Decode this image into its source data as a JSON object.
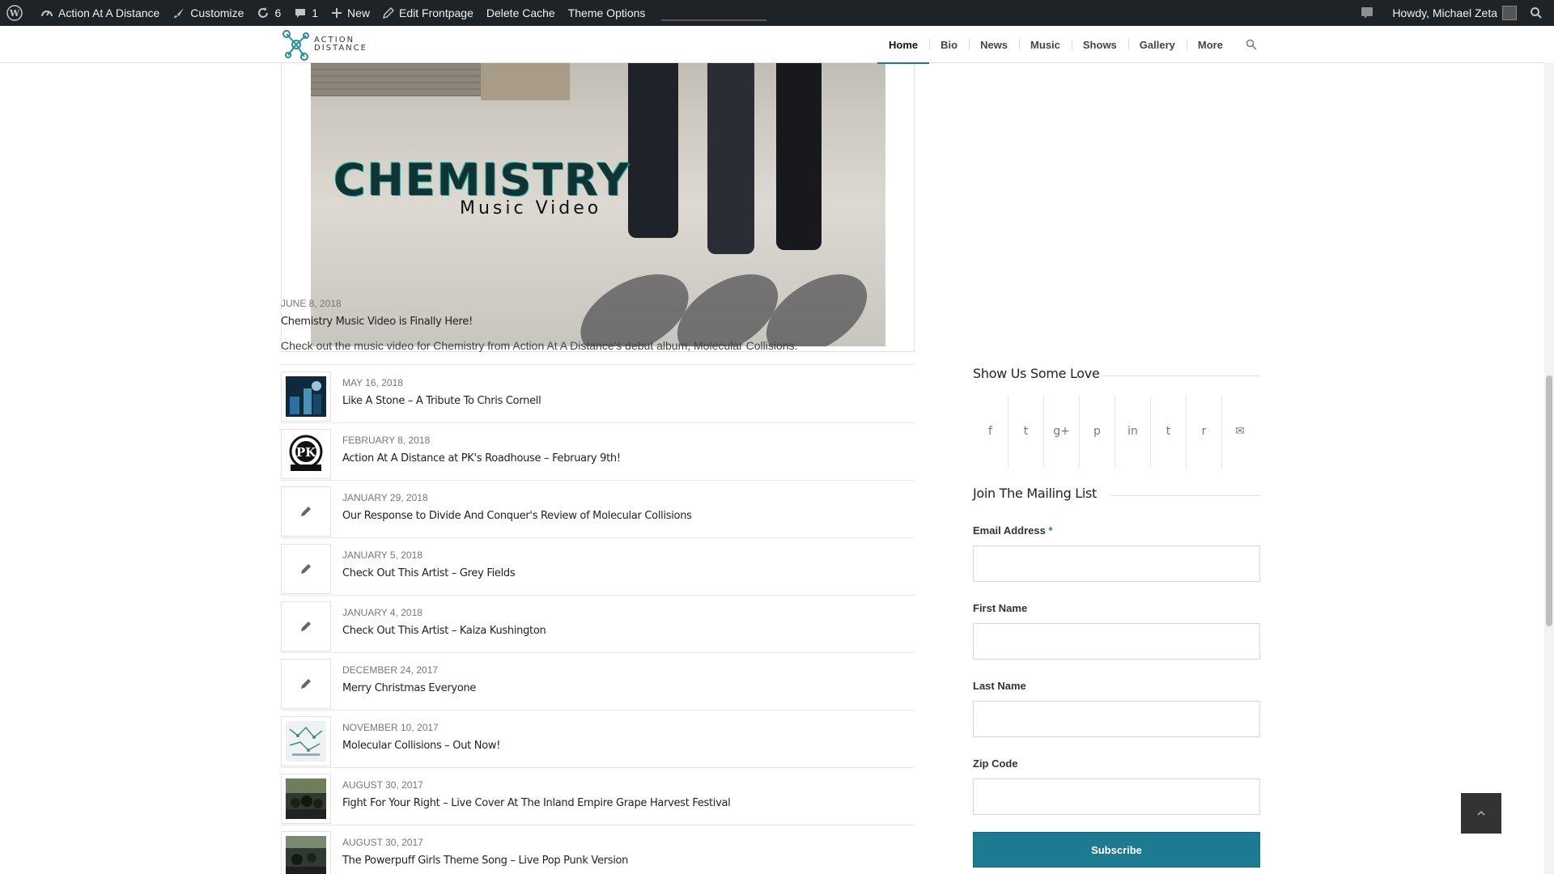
{
  "adminbar": {
    "site_name": "Action At A Distance",
    "customize": "Customize",
    "updates_count": "6",
    "comments_count": "1",
    "new": "New",
    "edit_frontpage": "Edit Frontpage",
    "delete_cache": "Delete Cache",
    "theme_options": "Theme Options",
    "howdy": "Howdy, Michael Zeta"
  },
  "logo": {
    "line1": "ACTION",
    "line2": "DISTANCE"
  },
  "nav": {
    "items": [
      {
        "label": "Home",
        "active": true
      },
      {
        "label": "Bio"
      },
      {
        "label": "News"
      },
      {
        "label": "Music"
      },
      {
        "label": "Shows"
      },
      {
        "label": "Gallery"
      },
      {
        "label": "More"
      }
    ]
  },
  "featured": {
    "image_title": "CHEMISTRY",
    "image_subtitle": "Music Video",
    "date": "JUNE 8, 2018",
    "title": "Chemistry Music Video is Finally Here!",
    "excerpt": "Check out the music video for Chemistry from Action At A Distance's debut album, Molecular Collisions."
  },
  "posts": [
    {
      "date": "MAY 16, 2018",
      "title": "Like A Stone – A Tribute To Chris Cornell",
      "thumb": "photo-dark"
    },
    {
      "date": "FEBRUARY 8, 2018",
      "title": "Action At A Distance at PK's Roadhouse – February 9th!",
      "thumb": "pk-logo"
    },
    {
      "date": "JANUARY 29, 2018",
      "title": "Our Response to Divide And Conquer's Review of Molecular Collisions",
      "thumb": "pencil-icon"
    },
    {
      "date": "JANUARY 5, 2018",
      "title": "Check Out This Artist – Grey Fields",
      "thumb": "pencil-icon"
    },
    {
      "date": "JANUARY 4, 2018",
      "title": "Check Out This Artist – Kaiza Kushington",
      "thumb": "pencil-icon"
    },
    {
      "date": "DECEMBER 24, 2017",
      "title": "Merry Christmas Everyone",
      "thumb": "pencil-icon"
    },
    {
      "date": "NOVEMBER 10, 2017",
      "title": "Molecular Collisions – Out Now!",
      "thumb": "album-art"
    },
    {
      "date": "AUGUST 30, 2017",
      "title": "Fight For Your Right – Live Cover At The Inland Empire Grape Harvest Festival",
      "thumb": "photo-crowd"
    },
    {
      "date": "AUGUST 30, 2017",
      "title": "The Powerpuff Girls Theme Song – Live Pop Punk Version",
      "thumb": "photo-crowd"
    }
  ],
  "sidebar": {
    "social_title": "Show Us Some Love",
    "social_icons": [
      "f",
      "t",
      "g+",
      "p",
      "in",
      "t",
      "r",
      "✉"
    ],
    "mailing_title": "Join The Mailing List",
    "email_label": "Email Address",
    "required_mark": "*",
    "first_name_label": "First Name",
    "last_name_label": "Last Name",
    "zip_label": "Zip Code",
    "subscribe_label": "Subscribe"
  },
  "colors": {
    "accent": "#1d7a91",
    "admin_bar": "#1d2327"
  }
}
